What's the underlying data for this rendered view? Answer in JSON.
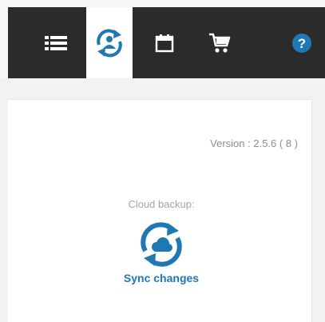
{
  "toolbar": {
    "items": [
      {
        "icon": "list-icon"
      },
      {
        "icon": "account-sync-icon",
        "active": true
      },
      {
        "icon": "calendar-icon"
      },
      {
        "icon": "cart-icon"
      },
      {
        "icon": "help-icon",
        "symbol": "?"
      }
    ]
  },
  "settings": {
    "version_label": "Version : 2.5.6  ( 8 )",
    "cloud_backup_label": "Cloud backup:",
    "sync_label": "Sync changes"
  },
  "colors": {
    "toolbar_bg": "#2b2b2b",
    "accent": "#1f77b4",
    "muted_text": "#8c8c8c"
  }
}
